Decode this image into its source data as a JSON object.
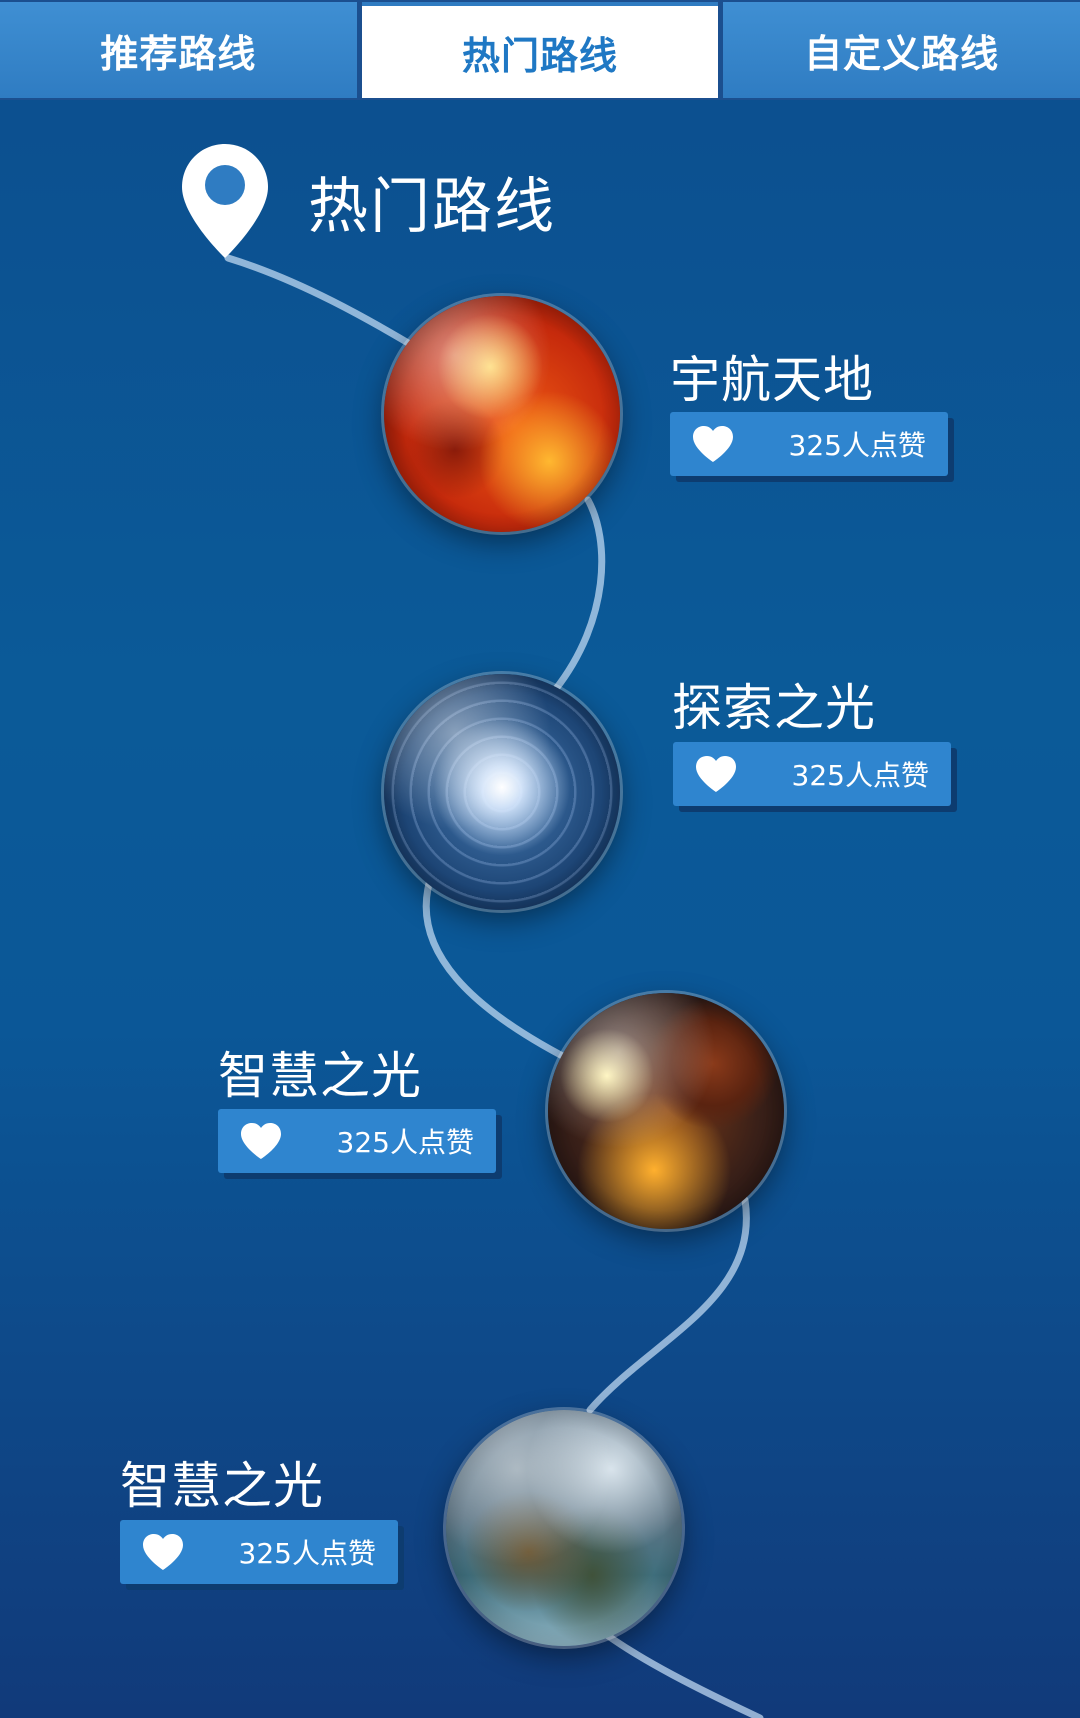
{
  "tabs": [
    {
      "label": "推荐路线",
      "active": false
    },
    {
      "label": "热门路线",
      "active": true
    },
    {
      "label": "自定义路线",
      "active": false
    }
  ],
  "section": {
    "title": "热门路线",
    "icon": "location-pin-icon"
  },
  "stops": [
    {
      "name": "宇航天地",
      "likes": "325人点赞",
      "planet": "fire-planet"
    },
    {
      "name": "探索之光",
      "likes": "325人点赞",
      "planet": "science-sphere"
    },
    {
      "name": "智慧之光",
      "likes": "325人点赞",
      "planet": "cosmos-sphere"
    },
    {
      "name": "智慧之光",
      "likes": "325人点赞",
      "planet": "dinosaur-sphere"
    }
  ],
  "colors": {
    "accent": "#2f85cf",
    "tab_active_text": "#1f78c4",
    "background_top": "#0c4e8e",
    "background_bottom": "#113a7a"
  }
}
